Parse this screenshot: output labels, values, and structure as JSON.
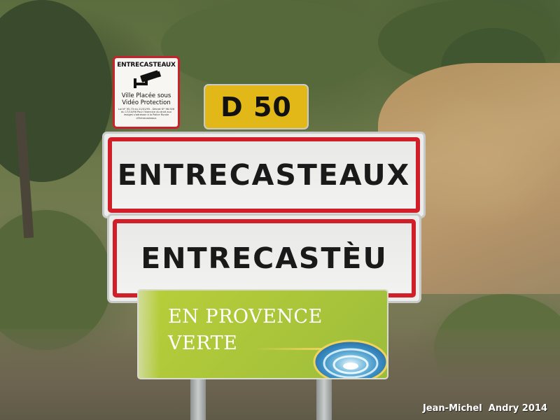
{
  "signs": {
    "surveillance": {
      "title": "ENTRECASTEAUX",
      "line1": "Ville Placée sous",
      "line2": "Vidéo Protection",
      "fine_print": "Loi N° 95-73 du 21/01/95 - Décret N° 96-926 du 17/10/96 Pour l'exercice du droit aux images s'adresser à la Police Rurale d'Entrecasteaux"
    },
    "road_number": "D 50",
    "town_name_french": "ENTRECASTEAUX",
    "town_name_provencal": "ENTRECASTÈU",
    "provence": {
      "line1": "EN PROVENCE",
      "line2": "VERTE"
    }
  },
  "photo_credit": "Jean-Michel  Andry 2014",
  "colors": {
    "sign_red": "#d01f29",
    "road_yellow": "#e2b818",
    "provence_green": "#a8c43a"
  },
  "icons": {
    "surveillance": "cctv-camera-icon",
    "provence_logo": "water-swirl-icon"
  }
}
